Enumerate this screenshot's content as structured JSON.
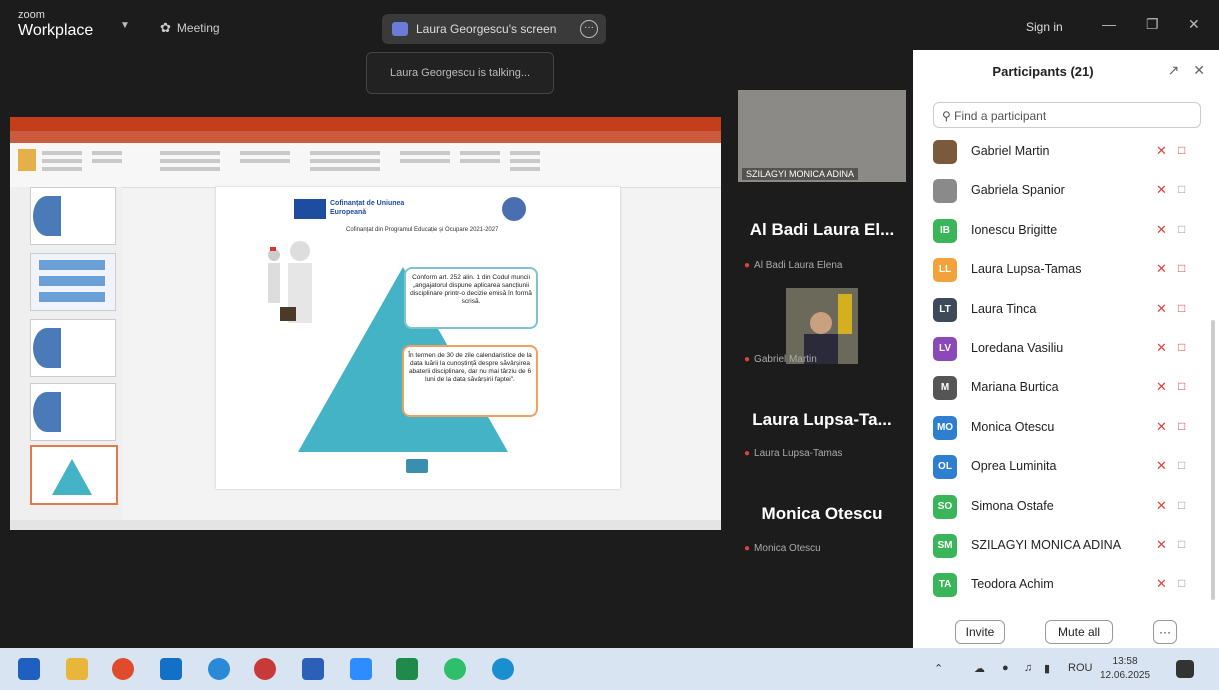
{
  "topbar": {
    "logo_small": "zoom",
    "logo_main": "Workplace",
    "meeting_label": "Meeting",
    "share_pill": "Laura Georgescu's screen",
    "talking_notice": "Laura Georgescu is talking...",
    "sign_in": "Sign in"
  },
  "slide": {
    "eu_text": "Cofinanțat de Uniunea Europeană",
    "subtitle": "Cofinanțat din Programul Educație și Ocupare 2021-2027",
    "box1": "Conform art. 252 alin. 1 din Codul muncii „angajatorul dispune aplicarea sancțiunii disciplinare printr-o decizie emisă în formă scrisă.",
    "box2": "În termen de 30 de zile calendaristice de la data luării la cunoștință despre săvârșirea abaterii disciplinare, dar nu mai târziu de 6 luni de la data săvârșirii faptei\"."
  },
  "videos": {
    "top_label": "SZILAGYI MONICA ADINA",
    "tiles": [
      {
        "name": "Al Badi Laura El...",
        "sub": "Al Badi Laura Elena"
      },
      {
        "name": "",
        "sub": "Gabriel Martin"
      },
      {
        "name": "Laura Lupsa-Ta...",
        "sub": "Laura Lupsa-Tamas"
      },
      {
        "name": "Monica Otescu",
        "sub": "Monica Otescu"
      }
    ]
  },
  "participants": {
    "title": "Participants (21)",
    "search_placeholder": "Find a participant",
    "items": [
      {
        "initials": "",
        "name": "Gabriel Martin",
        "color": "#7a5a3a",
        "cam_off": true
      },
      {
        "initials": "",
        "name": "Gabriela Spanior",
        "color": "#8a8a8a",
        "cam_off": false
      },
      {
        "initials": "IB",
        "name": "Ionescu Brigitte",
        "color": "#3bb55a",
        "cam_off": false
      },
      {
        "initials": "LL",
        "name": "Laura Lupsa-Tamas",
        "color": "#f2a23a",
        "cam_off": true
      },
      {
        "initials": "LT",
        "name": "Laura Tinca",
        "color": "#3d4a5a",
        "cam_off": true
      },
      {
        "initials": "LV",
        "name": "Loredana Vasiliu",
        "color": "#8a48b8",
        "cam_off": true
      },
      {
        "initials": "M",
        "name": "Mariana Burtica",
        "color": "#555555",
        "cam_off": true
      },
      {
        "initials": "MO",
        "name": "Monica Otescu",
        "color": "#2f7fd0",
        "cam_off": true
      },
      {
        "initials": "OL",
        "name": "Oprea Luminita",
        "color": "#2f7fd0",
        "cam_off": false
      },
      {
        "initials": "SO",
        "name": "Simona Ostafe",
        "color": "#3bb55a",
        "cam_off": false
      },
      {
        "initials": "SM",
        "name": "SZILAGYI MONICA ADINA",
        "color": "#3bb55a",
        "cam_off": false
      },
      {
        "initials": "TA",
        "name": "Teodora Achim",
        "color": "#3bb55a",
        "cam_off": false
      }
    ],
    "invite": "Invite",
    "mute_all": "Mute all",
    "more": "···"
  },
  "taskbar": {
    "lang": "ROU",
    "time": "13:58",
    "date": "12.06.2025"
  }
}
